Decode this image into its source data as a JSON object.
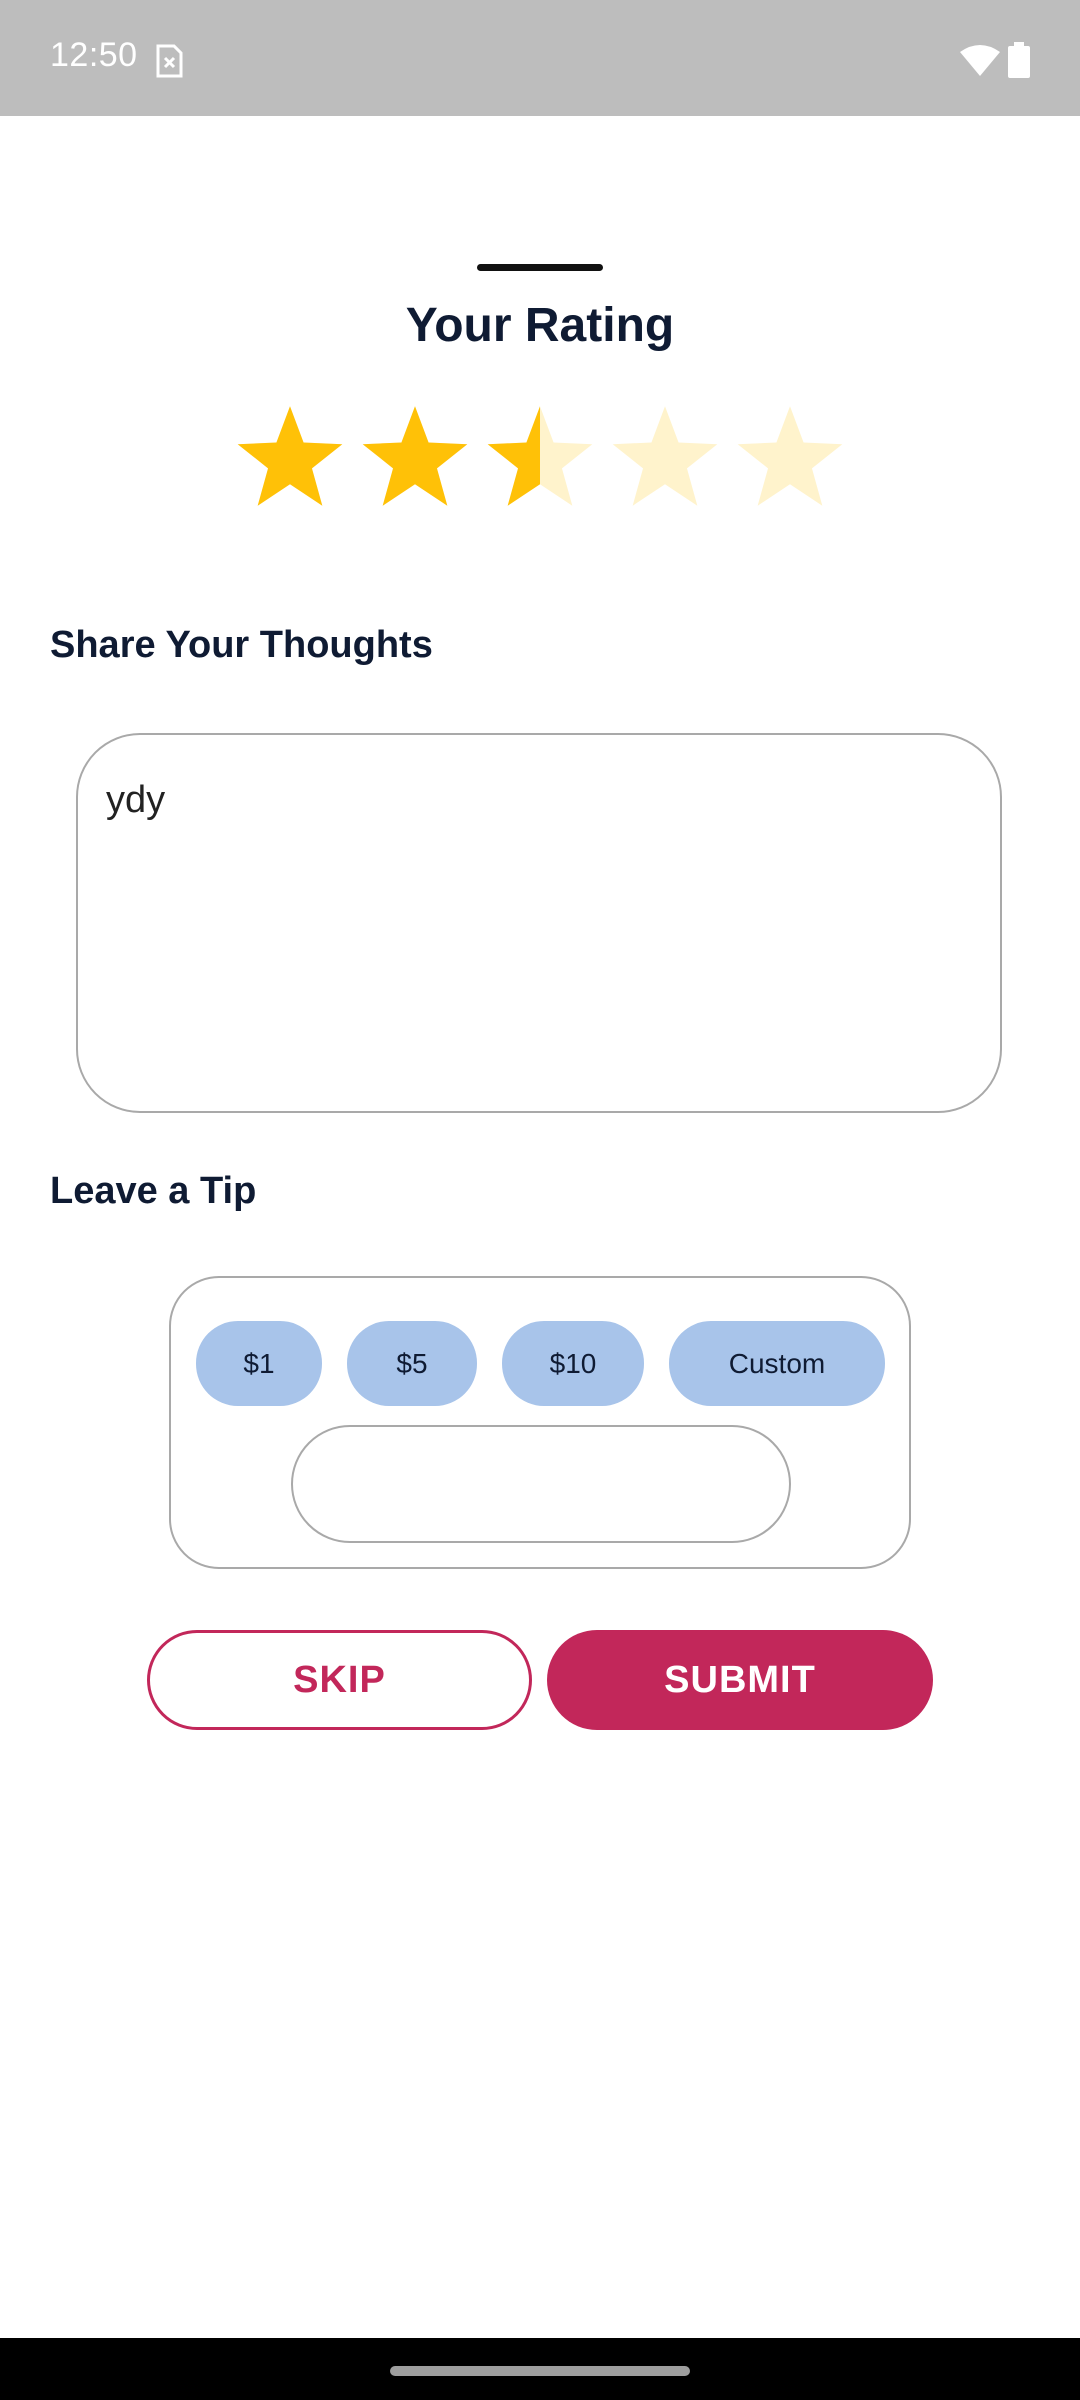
{
  "status_bar": {
    "time": "12:50"
  },
  "rating": {
    "title": "Your Rating",
    "value": 2.5,
    "max": 5,
    "filled_color": "#ffc107",
    "empty_color": "#fff3cc"
  },
  "thoughts": {
    "label": "Share Your Thoughts",
    "value": "ydy"
  },
  "tip": {
    "label": "Leave a Tip",
    "options": [
      "$1",
      "$5",
      "$10",
      "Custom"
    ],
    "custom_value": ""
  },
  "actions": {
    "skip_label": "SKIP",
    "submit_label": "SUBMIT",
    "accent_color": "#c2275a"
  }
}
